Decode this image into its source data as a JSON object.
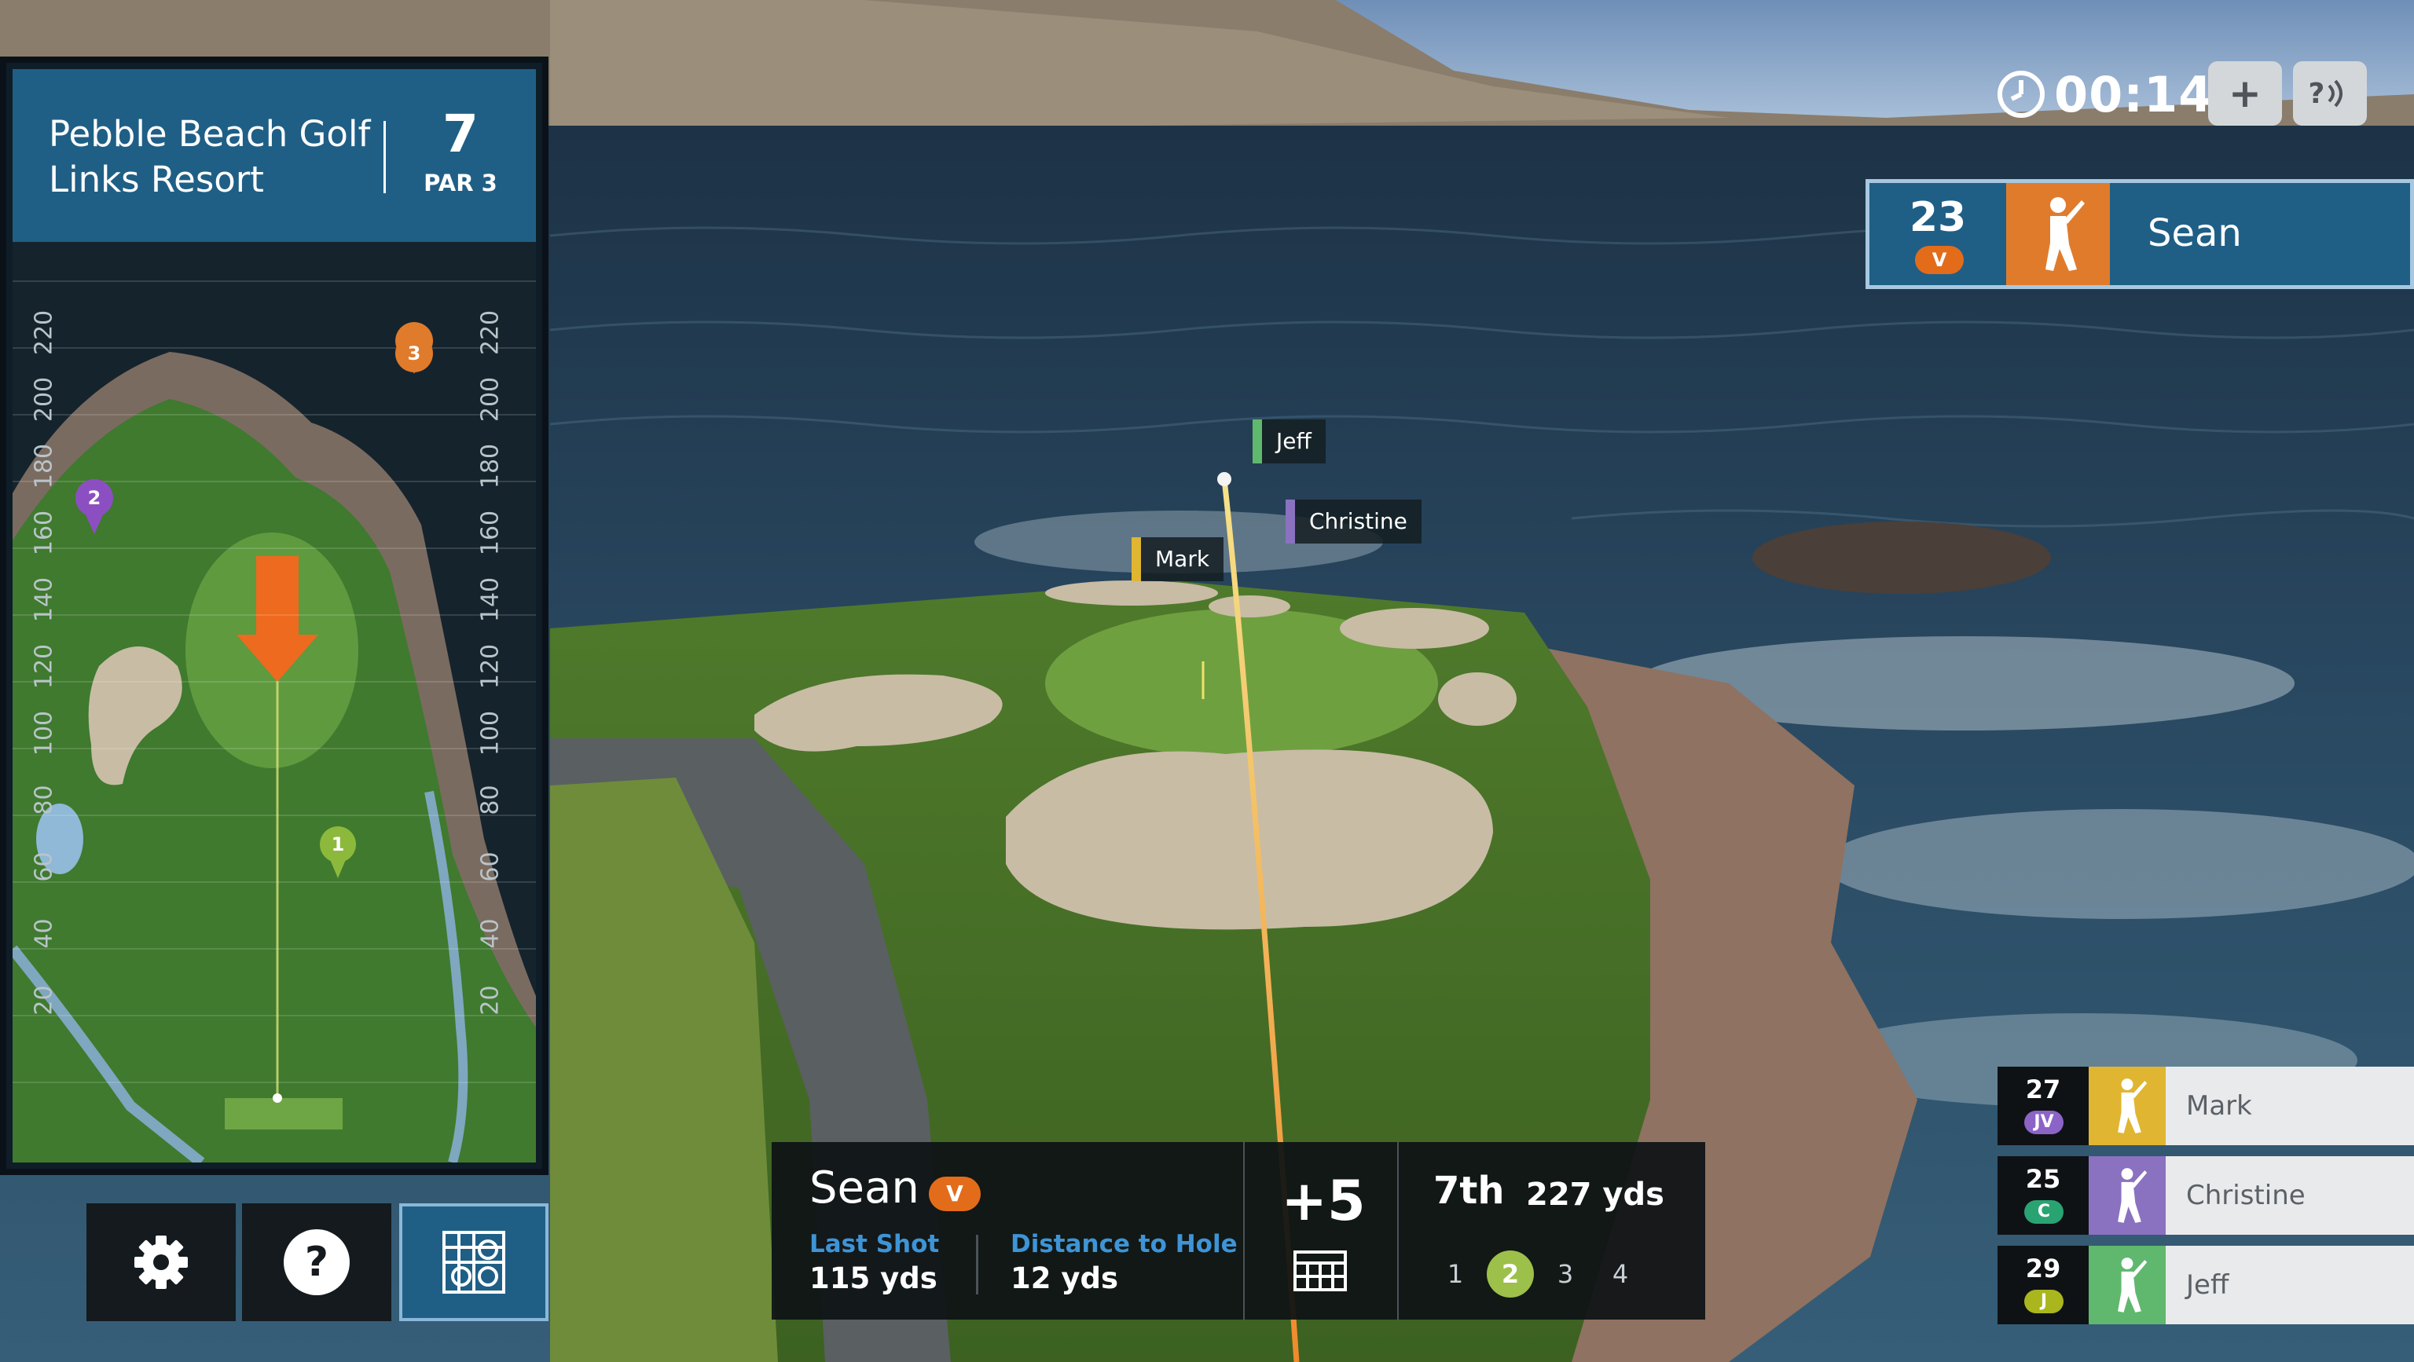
{
  "course": {
    "name": "Pebble Beach Golf Links Resort",
    "hole": "7",
    "par": "PAR 3"
  },
  "minimap": {
    "yards_left": [
      "220",
      "200",
      "180",
      "160",
      "140",
      "120",
      "100",
      "80",
      "60",
      "40",
      "20"
    ],
    "yards_right": [
      "220",
      "200",
      "180",
      "160",
      "140",
      "120",
      "100",
      "80",
      "60",
      "40",
      "20"
    ],
    "markers": [
      "1",
      "2",
      "3"
    ]
  },
  "timer": {
    "value": "00:14"
  },
  "top_buttons": {
    "add": "+",
    "help": "?"
  },
  "current_player": {
    "score": "23",
    "badge": "V",
    "name": "Sean"
  },
  "scoreboard": [
    {
      "score": "27",
      "badge": "JV",
      "name": "Mark",
      "color": "#e0b531",
      "badge_color": "#8c63c7"
    },
    {
      "score": "25",
      "badge": "C",
      "name": "Christine",
      "color": "#8a72c0",
      "badge_color": "#2aa373"
    },
    {
      "score": "29",
      "badge": "J",
      "name": "Jeff",
      "color": "#5fb86e",
      "badge_color": "#a9b61e"
    }
  ],
  "shot_panel": {
    "player": "Sean",
    "badge": "V",
    "last_shot_label": "Last Shot",
    "last_shot_value": "115 yds",
    "distance_label": "Distance to Hole",
    "distance_value": "12 yds",
    "score": "+5",
    "place": "7th",
    "total_distance": "227 yds",
    "shots": [
      "1",
      "2",
      "3",
      "4"
    ],
    "active_shot": "2"
  },
  "flags": [
    {
      "name": "Jeff",
      "color": "#5fb86e"
    },
    {
      "name": "Christine",
      "color": "#8a72c0"
    },
    {
      "name": "Mark",
      "color": "#e0b531"
    }
  ],
  "colors": {
    "accent_blue": "#1f5f86",
    "accent_orange": "#e07b2c",
    "highlight_green": "#9cc049"
  }
}
